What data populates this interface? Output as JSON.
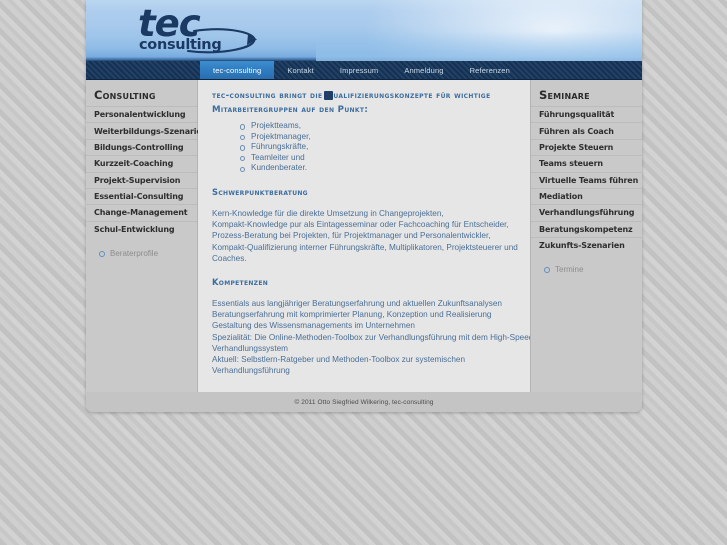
{
  "site": {
    "logo_primary": "tec",
    "logo_secondary": "consulting"
  },
  "nav": {
    "items": [
      {
        "label": "tec-consulting",
        "active": true
      },
      {
        "label": "Kontakt",
        "active": false
      },
      {
        "label": "Impressum",
        "active": false
      },
      {
        "label": "Anmeldung",
        "active": false
      },
      {
        "label": "Referenzen",
        "active": false
      }
    ]
  },
  "left_sidebar": {
    "heading": "Consulting",
    "items": [
      "Personalentwicklung",
      "Weiterbildungs-Szenarien",
      "Bildungs-Controlling",
      "Kurzzeit-Coaching",
      "Projekt-Supervision",
      "Essential-Consulting",
      "Change-Management",
      "Schul-Entwicklung"
    ],
    "sub_link": "Beraterprofile"
  },
  "right_sidebar": {
    "heading": "Seminare",
    "items": [
      "Führungsqualität",
      "Führen als Coach",
      "Projekte Steuern",
      "Teams steuern",
      "Virtuelle Teams führen",
      "Mediation",
      "Verhandlungsführung",
      "Beratungskompetenz",
      "Zukunfts-Szenarien"
    ],
    "sub_link": "Termine"
  },
  "main": {
    "intro_line1": "tec-consulting bringt die    Qualifizierungskonzepte für wichtige",
    "intro_line2": "Mitarbeitergruppen auf den Punkt:",
    "intro_list": [
      "Projektteams,",
      "Projektmanager,",
      "Führungskräfte,",
      "Teamleiter und",
      "Kundenberater."
    ],
    "sections": [
      {
        "heading": "Schwerpunktberatung",
        "lines": [
          "Kern-Knowledge für die direkte Umsetzung in Changeprojekten,",
          "Kompakt-Knowledge pur als Eintagesseminar oder Fachcoaching für Entscheider,",
          "Prozess-Beratung bei Projekten, für Projektmanager und Personalentwickler,",
          "Kompakt-Qualifizierung interner Führungskräfte, Multiplikatoren, Projektsteuerer und",
          "Coaches."
        ]
      },
      {
        "heading": "Kompetenzen",
        "lines": [
          "Essentials aus langjähriger Beratungserfahrung und aktuellen Zukunftsanalysen",
          "Beratungserfahrung mit komprimierter Planung, Konzeption und Realisierung",
          "Gestaltung des Wissensmanagements im Unternehmen",
          "Spezialität: Die Online-Methoden-Toolbox zur Verhandlungsführung mit dem High-Speed-",
          "Verhandlungssystem",
          "Aktuell: Selbstlern-Ratgeber und Methoden-Toolbox zur systemischen",
          "Verhandlungsführung"
        ]
      }
    ]
  },
  "footer": {
    "copyright": "© 2011 Otto Siegfried Wilkering, tec-consulting"
  },
  "colors": {
    "accent_blue": "#2f7cc0",
    "heading_blue": "#3d6d9e",
    "body_blue": "#4a6f96",
    "navy": "#16375c"
  }
}
